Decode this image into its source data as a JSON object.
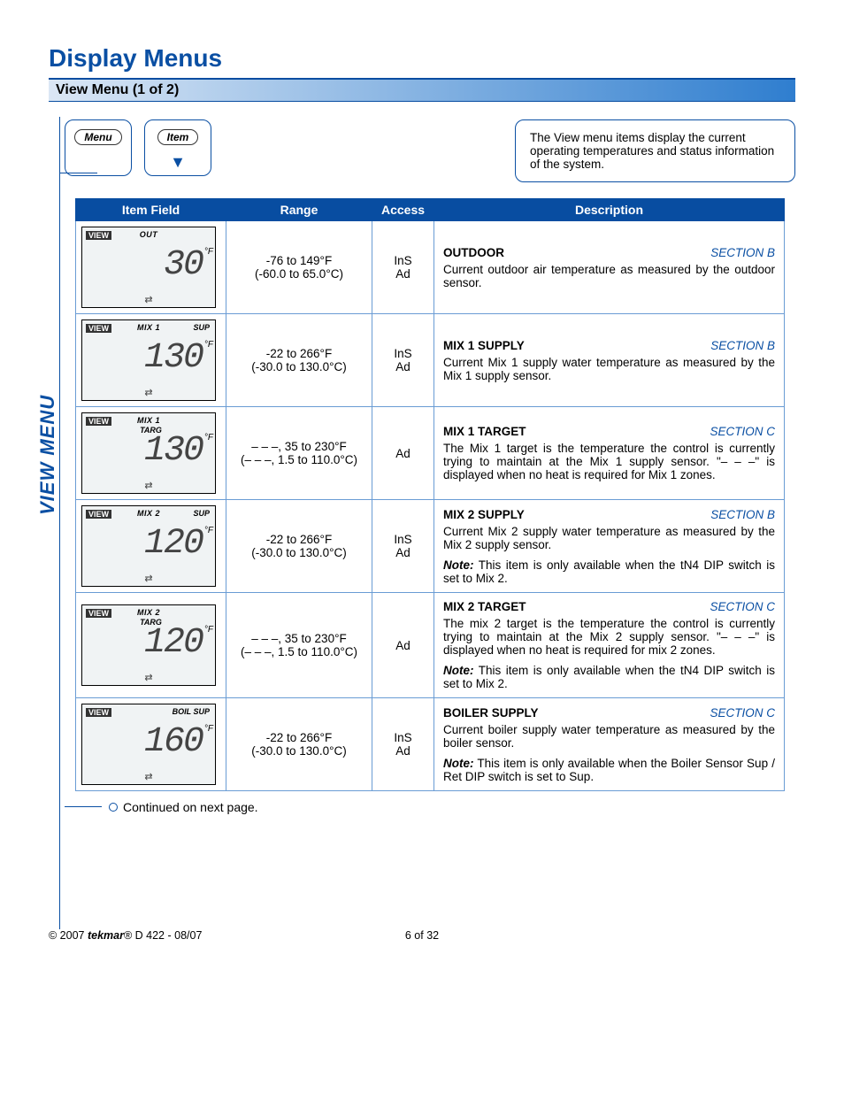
{
  "title": "Display Menus",
  "subheader": "View Menu (1 of 2)",
  "pills": {
    "menu": "Menu",
    "item": "Item"
  },
  "top_desc": "The View menu items display the current operating temperatures and status information of the system.",
  "side_label": "VIEW MENU",
  "headers": {
    "item": "Item Field",
    "range": "Range",
    "access": "Access",
    "desc": "Description"
  },
  "rows": [
    {
      "lcd": {
        "toplabel": "OUT",
        "targ": "",
        "topright": "",
        "value": "30",
        "unit": "°F"
      },
      "range_l1": "-76 to 149°F",
      "range_l2": "(-60.0 to 65.0°C)",
      "access_l1": "InS",
      "access_l2": "Ad",
      "desc_title": "OUTDOOR",
      "section": "SECTION B",
      "desc_body": "Current outdoor air temperature as measured by the outdoor sensor.",
      "note": ""
    },
    {
      "lcd": {
        "toplabel": "MIX 1",
        "targ": "",
        "topright": "SUP",
        "value": "130",
        "unit": "°F"
      },
      "range_l1": "-22 to 266°F",
      "range_l2": "(-30.0 to 130.0°C)",
      "access_l1": "InS",
      "access_l2": "Ad",
      "desc_title": "MIX 1 SUPPLY",
      "section": "SECTION B",
      "desc_body": "Current Mix 1 supply water temperature as measured by the Mix 1 supply sensor.",
      "note": ""
    },
    {
      "lcd": {
        "toplabel": "MIX 1",
        "targ": "TARG",
        "topright": "",
        "value": "130",
        "unit": "°F"
      },
      "range_l1": "– – –, 35 to 230°F",
      "range_l2": "(– – –, 1.5 to 110.0°C)",
      "access_l1": "",
      "access_l2": "Ad",
      "desc_title": "MIX 1 TARGET",
      "section": "SECTION C",
      "desc_body": "The Mix 1 target is the temperature the control is currently trying to maintain at the Mix 1 supply sensor. \"– – –\" is displayed when no heat is required for Mix 1 zones.",
      "note": ""
    },
    {
      "lcd": {
        "toplabel": "MIX  2",
        "targ": "",
        "topright": "SUP",
        "value": "120",
        "unit": "°F"
      },
      "range_l1": "-22 to 266°F",
      "range_l2": "(-30.0 to 130.0°C)",
      "access_l1": "InS",
      "access_l2": "Ad",
      "desc_title": "MIX 2 SUPPLY",
      "section": "SECTION B",
      "desc_body": "Current Mix 2 supply water temperature as measured by the Mix 2 supply sensor.",
      "note": "This item is only available when the tN4 DIP switch is set to Mix 2."
    },
    {
      "lcd": {
        "toplabel": "MIX  2",
        "targ": "TARG",
        "topright": "",
        "value": "120",
        "unit": "°F"
      },
      "range_l1": "– – –, 35 to 230°F",
      "range_l2": "(– – –, 1.5 to 110.0°C)",
      "access_l1": "",
      "access_l2": "Ad",
      "desc_title": "MIX 2 TARGET",
      "section": "SECTION C",
      "desc_body": "The mix 2 target is the temperature the control is currently trying to maintain at the Mix 2 supply sensor. \"– – –\" is displayed when no heat is required for mix 2 zones.",
      "note": "This item is only available when the tN4 DIP switch is set to Mix 2."
    },
    {
      "lcd": {
        "toplabel": "",
        "targ": "",
        "topright": "BOIL SUP",
        "value": "160",
        "unit": "°F"
      },
      "range_l1": "-22 to 266°F",
      "range_l2": "(-30.0 to 130.0°C)",
      "access_l1": "InS",
      "access_l2": "Ad",
      "desc_title": "BOILER SUPPLY",
      "section": "SECTION C",
      "desc_body": "Current boiler supply water temperature as measured by the boiler sensor.",
      "note": "This item is only available when the Boiler Sensor Sup / Ret DIP switch is set to Sup."
    }
  ],
  "continued": "Continued on next page.",
  "footer": {
    "left_prefix": "© 2007 ",
    "brand": "tekmar",
    "left_suffix": "® D 422 - 08/07",
    "center": "6 of 32"
  }
}
